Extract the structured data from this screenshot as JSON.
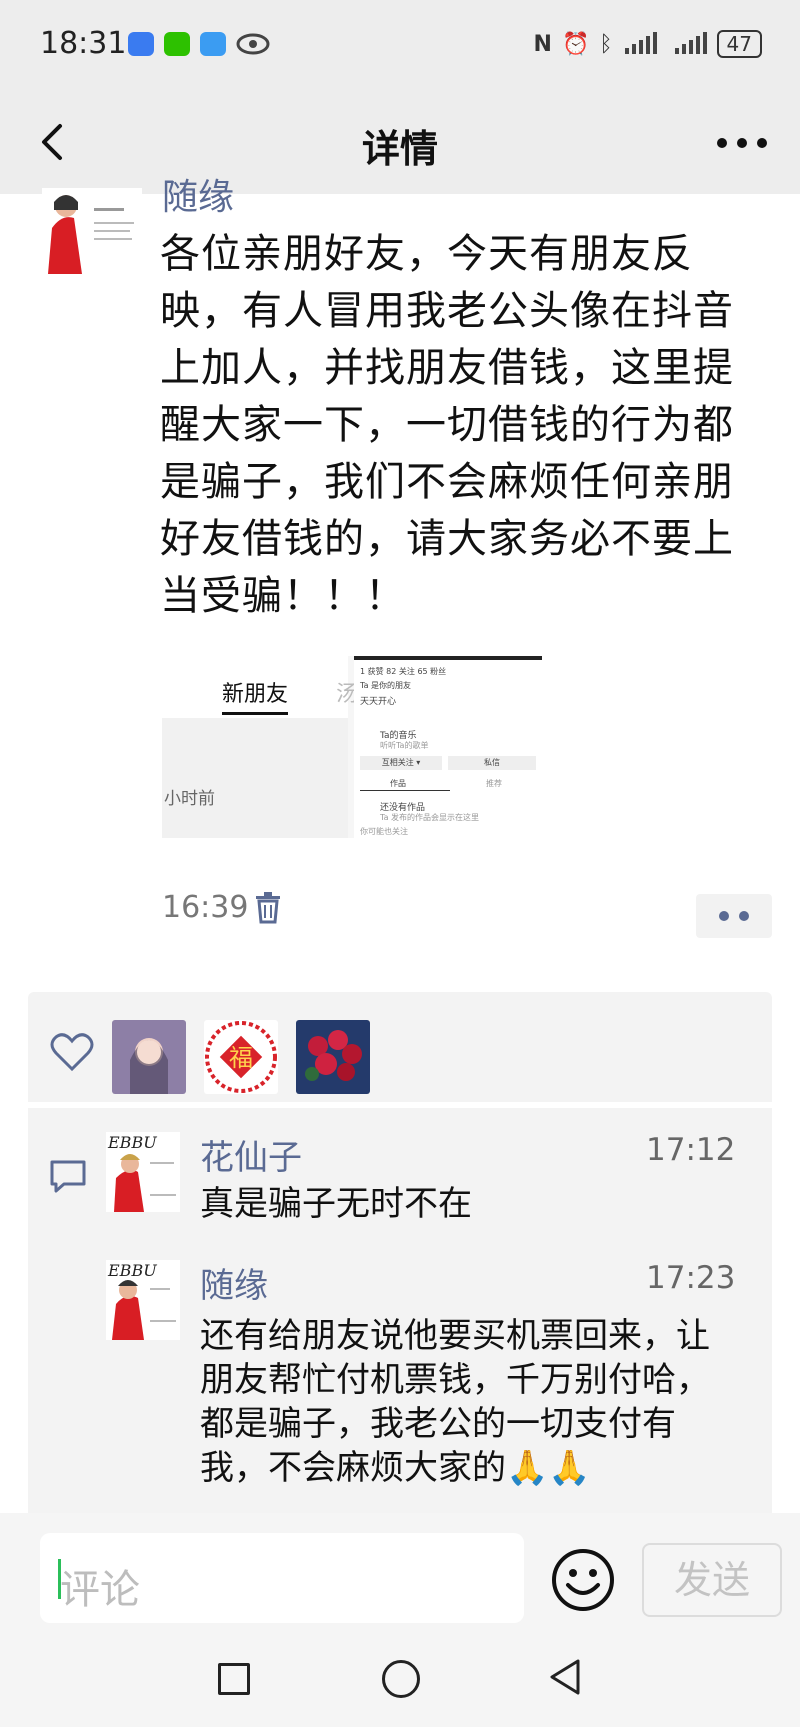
{
  "status_bar": {
    "time": "18:31",
    "app_icons": [
      "mail-icon",
      "wechat-icon",
      "message-icon",
      "eye-icon"
    ],
    "right_icons": [
      "nfc-icon",
      "alarm-icon",
      "bluetooth-icon",
      "signal-icon",
      "signal-icon"
    ],
    "battery": "47"
  },
  "titlebar": {
    "title": "详情"
  },
  "post": {
    "author": "随缘",
    "text": "各位亲朋好友，今天有朋友反映，有人冒用我老公头像在抖音上加人，并找朋友借钱，这里提醒大家一下，一切借钱的行为都是骗子，我们不会麻烦任何亲朋好友借钱的，请大家务必不要上当受骗！！！",
    "image_left": {
      "tab": "新朋友",
      "tab2": "汤",
      "time_text": "小时前"
    },
    "image_right": {
      "stats": "1 获赞  82 关注  65 粉丝",
      "friend_tag": "Ta 是你的朋友",
      "bio": "天天开心",
      "music_title": "Ta的音乐",
      "music_sub": "听听Ta的歌单",
      "follow_btn": "互相关注 ▾",
      "msg_btn": "私信",
      "tab_works": "作品",
      "tab_recommend": "推荐",
      "empty_title": "还没有作品",
      "empty_sub": "Ta 发布的作品会显示在这里",
      "footer": "你可能也关注"
    },
    "time": "16:39"
  },
  "likes": {
    "avatars": [
      "girl-avatar",
      "fu-avatar",
      "flowers-avatar"
    ]
  },
  "comments": [
    {
      "name": "花仙子",
      "time": "17:12",
      "text": "真是骗子无时不在"
    },
    {
      "name": "随缘",
      "time": "17:23",
      "text": "还有给朋友说他要买机票回来，让朋友帮忙付机票钱，千万别付哈，都是骗子，我老公的一切支付有我，不会麻烦大家的🙏🙏"
    }
  ],
  "input": {
    "placeholder": "评论",
    "send_label": "发送"
  },
  "colors": {
    "name_link": "#5a6a93",
    "panel_bg": "#f3f3f3",
    "caret": "#2bbf5a"
  }
}
